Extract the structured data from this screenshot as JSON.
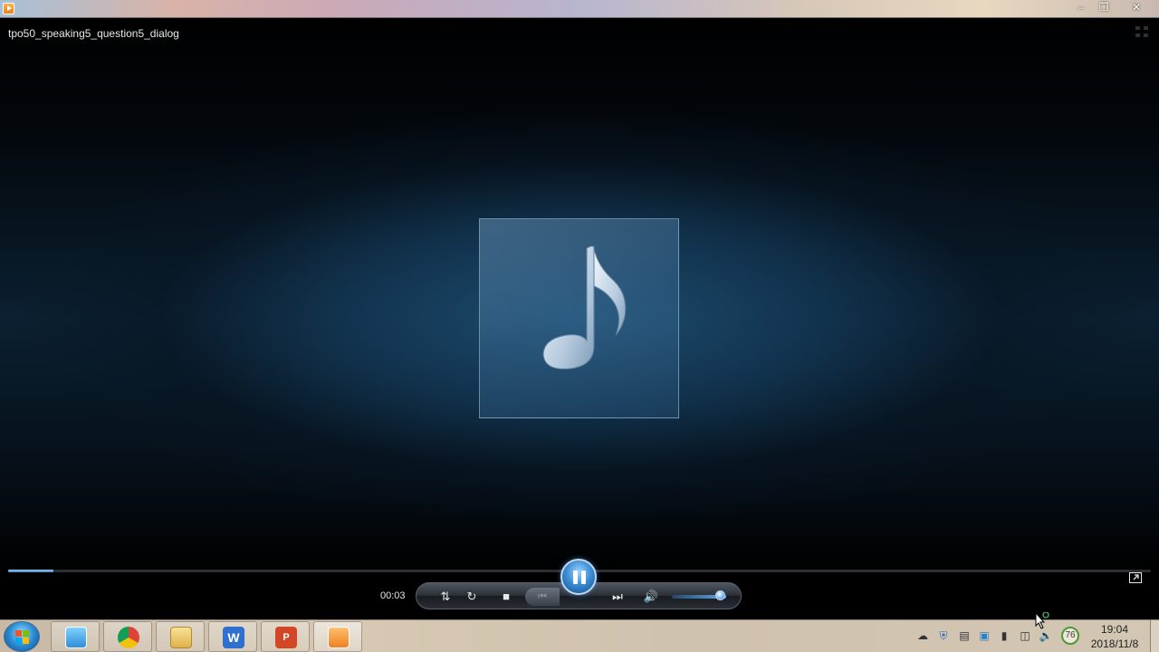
{
  "window": {
    "title": "",
    "minimize_icon": "minimize-icon",
    "maximize_icon": "restore-icon",
    "close_icon": "close-icon"
  },
  "player": {
    "media_title": "tpo50_speaking5_question5_dialog",
    "album_art_icon": "music-note-icon",
    "elapsed_time": "00:03",
    "progress_fraction": 0.04,
    "volume_fraction": 0.9,
    "state": "playing",
    "controls": {
      "shuffle_icon": "shuffle-icon",
      "repeat_icon": "repeat-icon",
      "stop_icon": "stop-icon",
      "previous_icon": "previous-icon",
      "pause_icon": "pause-icon",
      "next_icon": "next-icon",
      "mute_icon": "speaker-icon",
      "switch_view_icon": "switch-to-library-icon"
    }
  },
  "taskbar": {
    "start_icon": "windows-start-icon",
    "pinned": [
      {
        "name": "live-icon"
      },
      {
        "name": "chrome-icon"
      },
      {
        "name": "file-explorer-icon"
      },
      {
        "name": "wps-writer-icon"
      },
      {
        "name": "powerpoint-icon"
      },
      {
        "name": "media-player-icon"
      }
    ],
    "tray_icons": [
      "cloud-icon",
      "shield-icon",
      "display-icon",
      "network-app-icon",
      "usb-icon",
      "network-icon",
      "volume-icon"
    ],
    "tray_badge": "76",
    "clock_time": "19:04",
    "clock_date": "2018/11/8"
  }
}
